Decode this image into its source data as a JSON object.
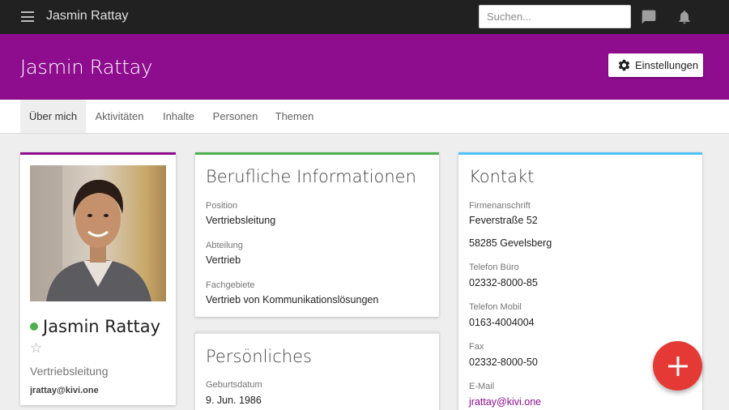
{
  "app": {
    "title": "Jasmin Rattay"
  },
  "search": {
    "placeholder": "Suchen..."
  },
  "icons": {
    "menu": "hamburger-menu-icon",
    "chat": "chat-icon",
    "notifications": "bell-icon",
    "settings": "gear-icon",
    "add": "plus-icon",
    "favorite": "star-outline-icon",
    "status": "online-status-dot"
  },
  "colors": {
    "brand": "#8e0c8e",
    "topbar": "#212121",
    "fab": "#e53935",
    "online": "#4caf50",
    "profile_accent": "#8e0c8e",
    "work_accent": "#4caf50",
    "contact_accent": "#4fc3f7",
    "personal_accent": "#bdbdbd"
  },
  "header": {
    "name": "Jasmin Rattay",
    "settings_label": "Einstellungen"
  },
  "tabs": [
    {
      "label": "Über mich",
      "active": true
    },
    {
      "label": "Aktivitäten",
      "active": false
    },
    {
      "label": "Inhalte",
      "active": false
    },
    {
      "label": "Personen",
      "active": false
    },
    {
      "label": "Themen",
      "active": false
    }
  ],
  "profile": {
    "name": "Jasmin Rattay",
    "position": "Vertriebsleitung",
    "email": "jrattay@kivi.one"
  },
  "work": {
    "title": "Berufliche Informationen",
    "fields": [
      {
        "label": "Position",
        "value": "Vertriebsleitung"
      },
      {
        "label": "Abteilung",
        "value": "Vertrieb"
      },
      {
        "label": "Fachgebiete",
        "value": "Vertrieb von Kommunikationslösungen"
      }
    ]
  },
  "personal": {
    "title": "Persönliches",
    "fields": [
      {
        "label": "Geburtsdatum",
        "value": "9. Jun. 1986"
      }
    ]
  },
  "contact": {
    "title": "Kontakt",
    "address_label": "Firmenanschrift",
    "address_line1": "Feverstraße 52",
    "address_line2": "58285 Gevelsberg",
    "phone_office_label": "Telefon Büro",
    "phone_office": "02332-8000-85",
    "phone_mobile_label": "Telefon Mobil",
    "phone_mobile": "0163-4004004",
    "fax_label": "Fax",
    "fax": "02332-8000-50",
    "email_label": "E-Mail",
    "email": "jrattay@kivi.one"
  }
}
